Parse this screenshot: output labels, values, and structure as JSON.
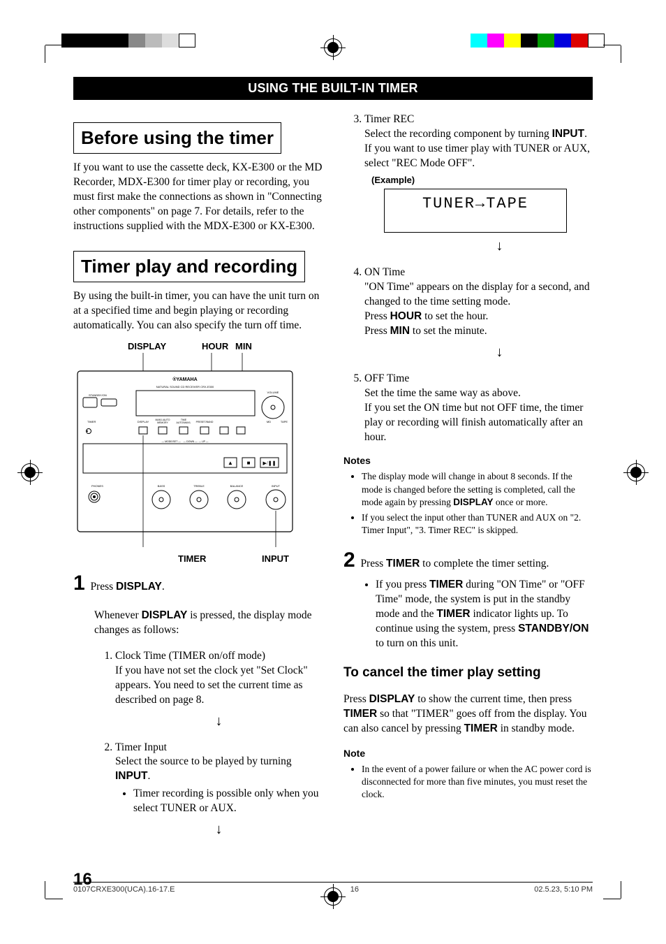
{
  "header": "USING THE BUILT-IN TIMER",
  "section1": {
    "title": "Before using the timer",
    "body": "If you want to use the cassette deck, KX-E300 or the MD Recorder, MDX-E300 for timer play or recording, you must first make the connections as shown in \"Connecting other components\" on page 7. For details, refer to the instructions supplied with the MDX-E300 or KX-E300."
  },
  "section2": {
    "title": "Timer play and recording",
    "body": "By using the built-in timer, you can have the unit turn on at a specified time and begin playing or recording automatically. You can also specify the turn off time."
  },
  "diagram": {
    "top_labels": {
      "display": "DISPLAY",
      "hour": "HOUR",
      "min": "MIN"
    },
    "bottom_labels": {
      "timer": "TIMER",
      "input": "INPUT"
    },
    "brand": "YAMAHA",
    "subbrand": "NATURAL SOUND CD RECEIVER CRX-E300",
    "panel": {
      "standby": "STANDBY/ON",
      "volume": "VOLUME",
      "timer": "TIMER",
      "display": "DISPLAY",
      "memory": "MEMORY",
      "time": "TIME",
      "automan": "AUTO/MAN'L",
      "preset": "PRESET/BAND",
      "md": "MD",
      "tape": "TAPE",
      "mode": "MODE/SET",
      "down": "DOWN",
      "up": "UP",
      "phones": "PHONES",
      "bass": "BASS",
      "treble": "TREBLE",
      "balance": "BALANCE",
      "input": "INPUT"
    }
  },
  "step1": {
    "num": "1",
    "lead_a": "Press ",
    "lead_b": "DISPLAY",
    "lead_c": ".",
    "cont_a": "Whenever ",
    "cont_b": "DISPLAY",
    "cont_c": " is pressed, the display mode changes as follows:",
    "items": [
      {
        "title": "Clock Time (TIMER on/off mode)",
        "body": "If you have not set the clock yet \"Set Clock\" appears. You need to set the current time as described on page 8."
      },
      {
        "title": "Timer Input",
        "body_a": "Select the source to be played by turning ",
        "body_b": "INPUT",
        "body_c": ".",
        "bullet": "Timer recording is possible only when you select TUNER or AUX."
      },
      {
        "title": "Timer REC",
        "body_a": "Select the recording component by turning ",
        "body_b": "INPUT",
        "body_c": ". If you want to use timer play with TUNER or AUX, select \"REC Mode OFF\".",
        "example_label": "(Example)",
        "lcd": "TUNER→TAPE"
      },
      {
        "title": "ON Time",
        "line1": "\"ON Time\" appears on the display for a second, and changed to the time setting mode.",
        "line2_a": "Press ",
        "line2_b": "HOUR",
        "line2_c": " to set the hour.",
        "line3_a": "Press ",
        "line3_b": "MIN",
        "line3_c": " to set the minute."
      },
      {
        "title": "OFF Time",
        "line1": "Set the time the same way as above.",
        "line2": "If you set the ON time but not OFF time, the timer play or recording will finish automatically after an hour."
      }
    ]
  },
  "notes1": {
    "heading": "Notes",
    "items": [
      {
        "a": "The display mode will change in about 8 seconds. If the mode is changed before the setting is completed, call the mode again by pressing ",
        "b": "DISPLAY",
        "c": " once or more."
      },
      {
        "a": "If you select the input other than TUNER and AUX on \"2. Timer Input\", \"3. Timer REC\" is skipped.",
        "b": "",
        "c": ""
      }
    ]
  },
  "step2": {
    "num": "2",
    "lead_a": "Press ",
    "lead_b": "TIMER",
    "lead_c": " to complete the timer setting.",
    "bullet": {
      "a": "If you press ",
      "b": "TIMER",
      "c": " during \"ON Time\" or \"OFF Time\" mode, the system is put in the standby mode and the ",
      "d": "TIMER",
      "e": " indicator lights up. To continue using the system, press ",
      "f": "STANDBY/ON",
      "g": " to turn on this unit."
    }
  },
  "cancel": {
    "heading": "To cancel the timer play setting",
    "body": {
      "a": "Press ",
      "b": "DISPLAY",
      "c": " to show the current time, then press ",
      "d": "TIMER",
      "e": " so that \"TIMER\" goes off from the display. You can also cancel by pressing ",
      "f": "TIMER",
      "g": " in standby mode."
    }
  },
  "notes2": {
    "heading": "Note",
    "item": "In the event of a power failure or when the AC power cord is disconnected for more than five minutes, you must reset the clock."
  },
  "page_number": "16",
  "footer": {
    "left": "0107CRXE300(UCA).16-17.E",
    "center": "16",
    "right": "02.5.23, 5:10 PM"
  }
}
